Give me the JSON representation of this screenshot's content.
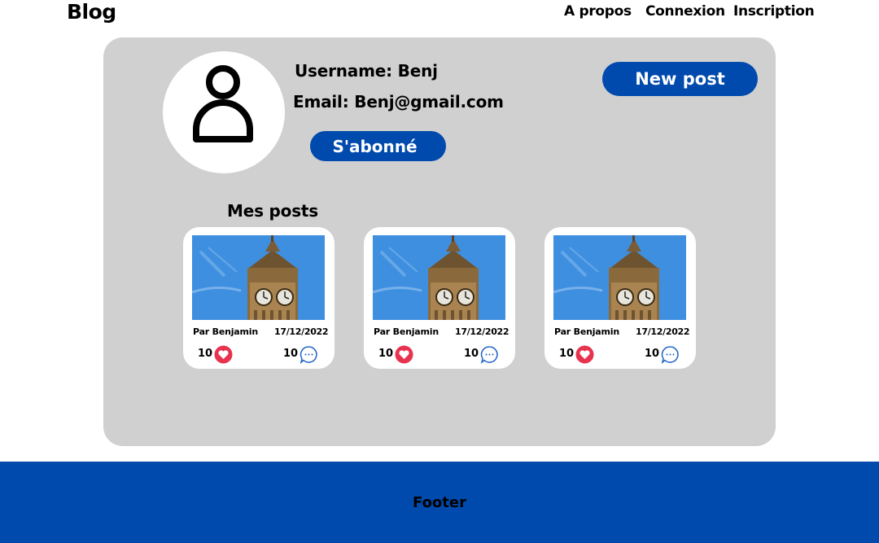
{
  "header": {
    "brand": "Blog",
    "nav": [
      {
        "label": "A propos"
      },
      {
        "label": "Connexion"
      },
      {
        "label": "Inscription"
      }
    ]
  },
  "profile": {
    "username": "Username: Benj",
    "email": "Email: Benj@gmail.com",
    "subscribe_label": "S'abonné",
    "new_post_label": "New post",
    "avatar_icon": "user-icon"
  },
  "posts_section": {
    "title": "Mes posts",
    "posts": [
      {
        "author": "Par Benjamin",
        "date": "17/12/2022",
        "likes": "10",
        "comments": "10",
        "image_icon": "big-ben-image"
      },
      {
        "author": "Par Benjamin",
        "date": "17/12/2022",
        "likes": "10",
        "comments": "10",
        "image_icon": "big-ben-image"
      },
      {
        "author": "Par Benjamin",
        "date": "17/12/2022",
        "likes": "10",
        "comments": "10",
        "image_icon": "big-ben-image"
      }
    ]
  },
  "footer": {
    "text": "Footer"
  },
  "colors": {
    "accent": "#004aad",
    "panel": "#d0d0d0",
    "heart": "#e8334f",
    "comment_icon": "#1f63c7"
  }
}
